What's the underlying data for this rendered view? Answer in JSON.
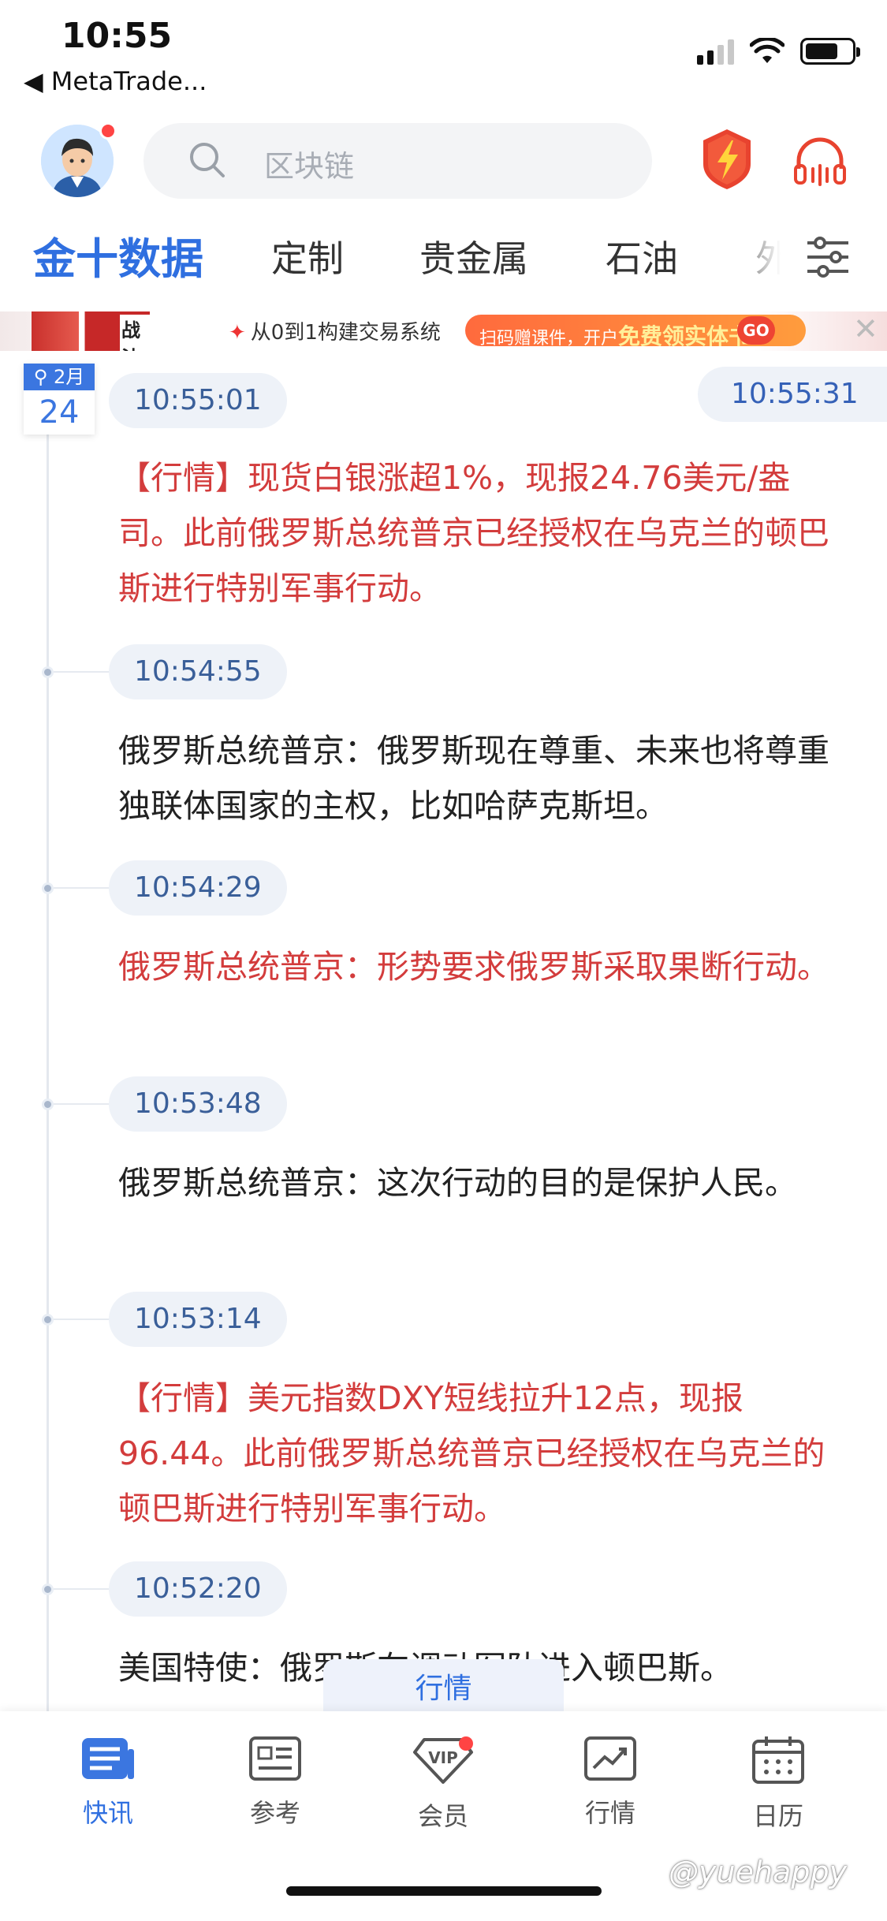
{
  "status_bar": {
    "time": "10:55",
    "back_app": "◀ MetaTrade..."
  },
  "search": {
    "placeholder": "区块链"
  },
  "tabs": [
    "金十数据",
    "定制",
    "贵金属",
    "石油",
    "外"
  ],
  "banner": {
    "book_title": "战法",
    "text": "从0到1构建交易系统",
    "cta_prefix": "扫码赠课件，开户",
    "cta_highlight": "免费领实体书",
    "go": "GO"
  },
  "date": {
    "month": "2月",
    "day": "24"
  },
  "latest_time": "10:55:31",
  "feed": [
    {
      "time": "10:55:01",
      "text": "【行情】现货白银涨超1%，现报24.76美元/盎司。此前俄罗斯总统普京已经授权在乌克兰的顿巴斯进行特别军事行动。",
      "important": true
    },
    {
      "time": "10:54:55",
      "text": "俄罗斯总统普京：俄罗斯现在尊重、未来也将尊重独联体国家的主权，比如哈萨克斯坦。",
      "important": false
    },
    {
      "time": "10:54:29",
      "text": "俄罗斯总统普京：形势要求俄罗斯采取果断行动。",
      "important": true
    },
    {
      "time": "10:53:48",
      "text": "俄罗斯总统普京：这次行动的目的是保护人民。",
      "important": false
    },
    {
      "time": "10:53:14",
      "text": "【行情】美元指数DXY短线拉升12点，现报96.44。此前俄罗斯总统普京已经授权在乌克兰的顿巴斯进行特别军事行动。",
      "important": true
    },
    {
      "time": "10:52:20",
      "text": "美国特使：俄罗斯在调动军队进入顿巴斯。",
      "important": false
    }
  ],
  "floating_tab": "行情",
  "nav": [
    {
      "label": "快讯",
      "icon": "news-icon",
      "active": true
    },
    {
      "label": "参考",
      "icon": "reference-icon",
      "active": false
    },
    {
      "label": "会员",
      "icon": "vip-icon",
      "active": false
    },
    {
      "label": "行情",
      "icon": "market-chart-icon",
      "active": false
    },
    {
      "label": "日历",
      "icon": "calendar-icon",
      "active": false
    }
  ],
  "watermark": "@yuehappy",
  "colors": {
    "accent": "#2f6fe0",
    "important_text": "#d33c3c",
    "time_pill_bg": "#eef2f8"
  }
}
